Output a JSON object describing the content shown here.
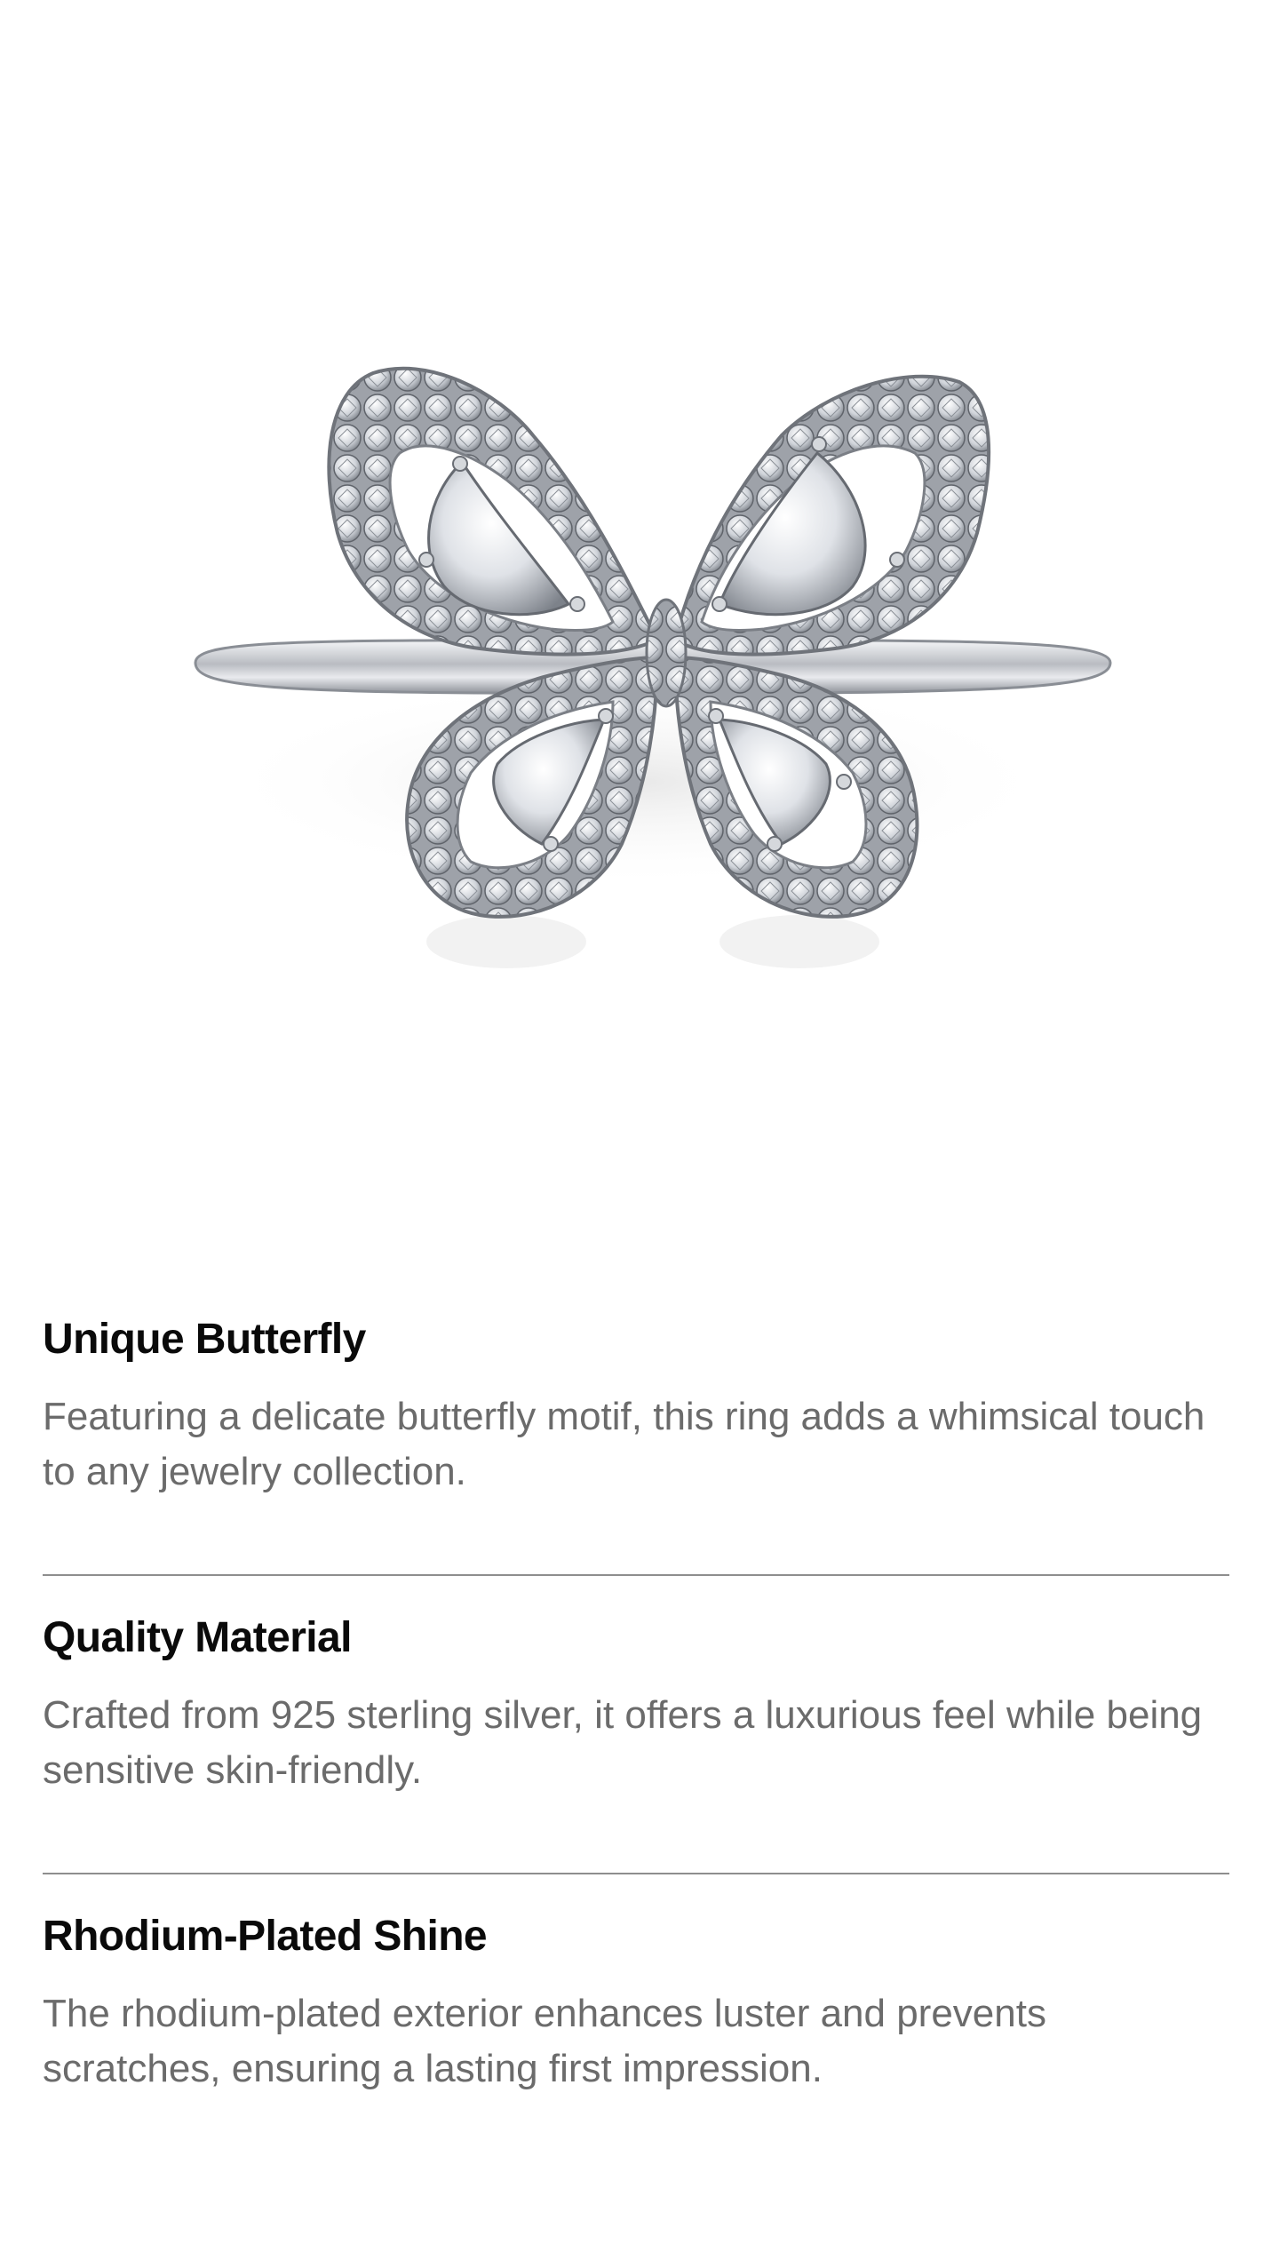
{
  "product": {
    "image_alt": "Butterfly ring with pavé stones",
    "metal_color": "#c9ccd1",
    "stone_color": "#eef0f3"
  },
  "features": [
    {
      "title": "Unique Butterfly",
      "description": "Featuring a delicate butterfly motif, this ring adds a whimsical touch to any jewelry collection."
    },
    {
      "title": "Quality Material",
      "description": "Crafted from 925 sterling silver, it offers a luxurious feel while being sensitive skin-friendly."
    },
    {
      "title": "Rhodium-Plated Shine",
      "description": "The rhodium-plated exterior enhances luster and prevents scratches, ensuring a lasting first impression."
    }
  ],
  "colors": {
    "title": "#0a0a0a",
    "body": "#6b6b6b",
    "divider": "#8e8e8e",
    "background": "#ffffff"
  }
}
